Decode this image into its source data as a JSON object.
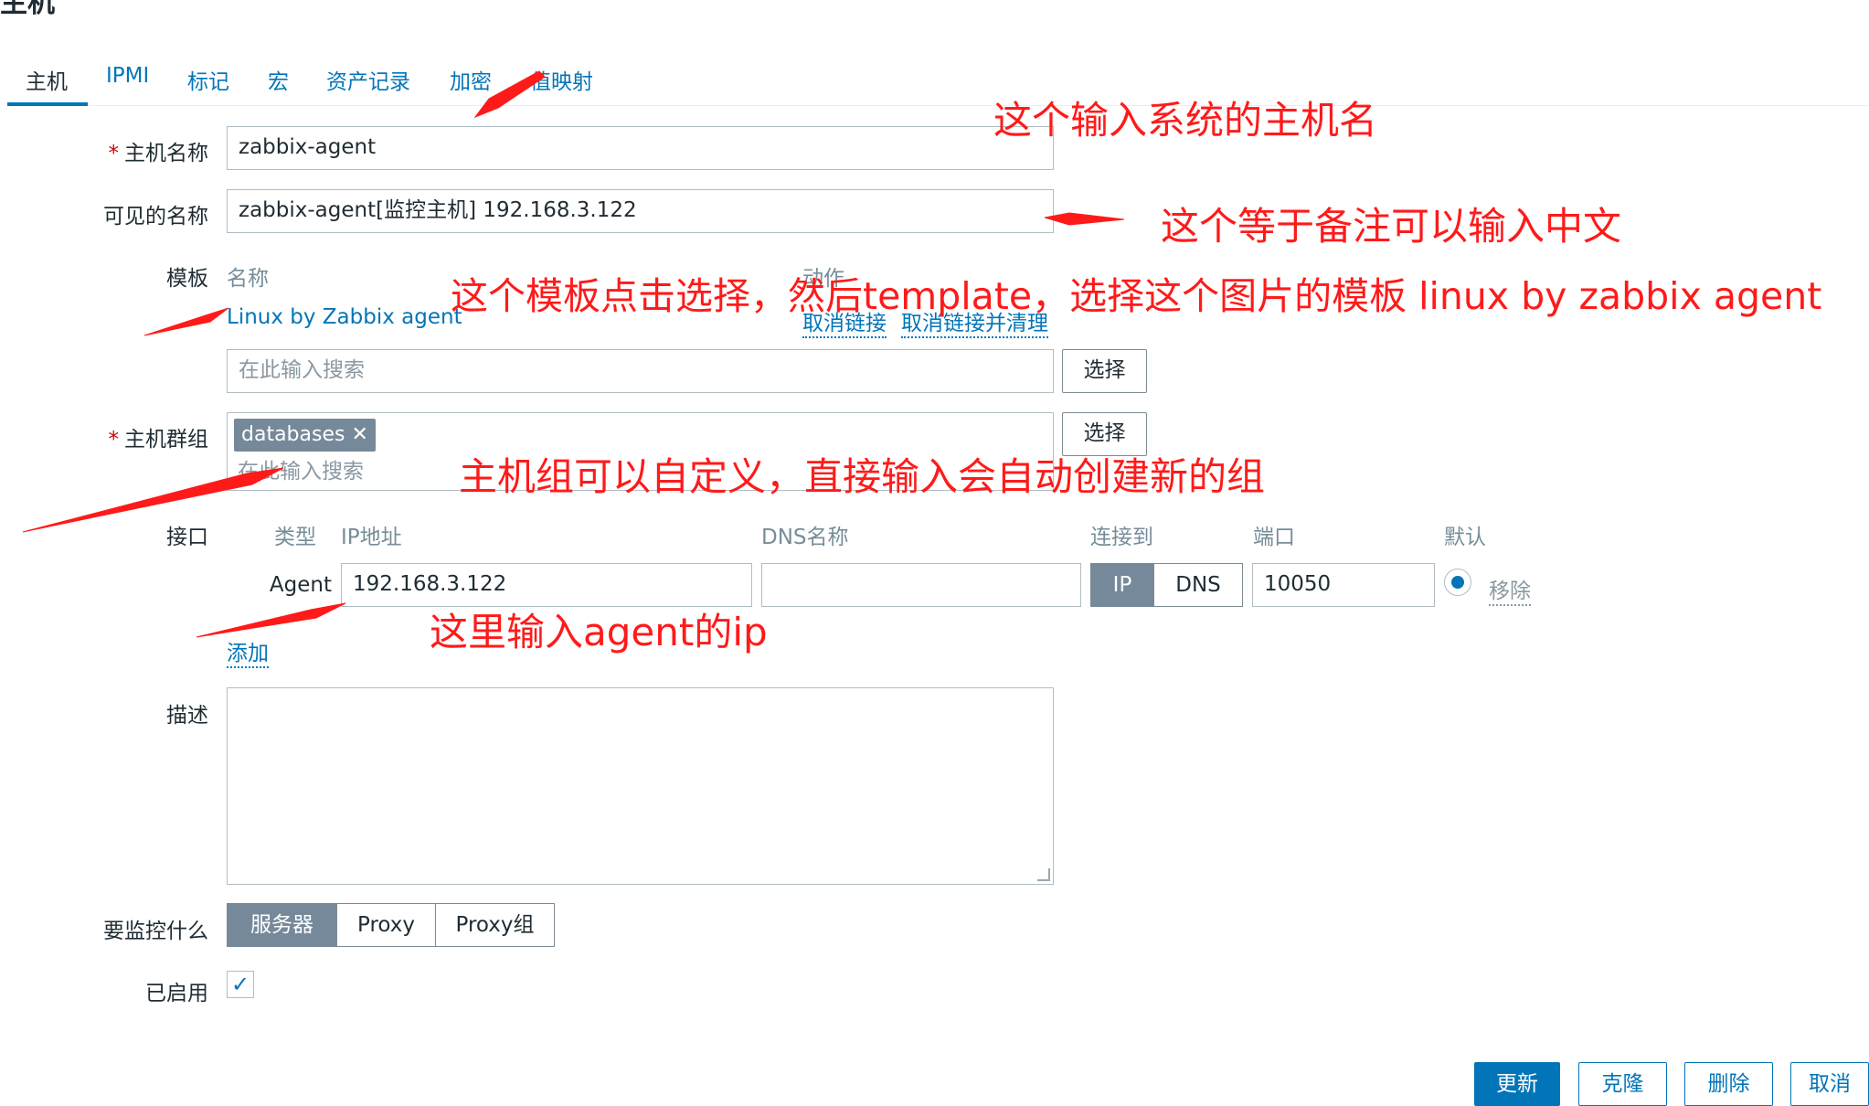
{
  "page": {
    "title": "主机"
  },
  "tabs": [
    "主机",
    "IPMI",
    "标记",
    "宏",
    "资产记录",
    "加密",
    "值映射"
  ],
  "form": {
    "hostname": {
      "label": "主机名称",
      "value": "zabbix-agent"
    },
    "visible_name": {
      "label": "可见的名称",
      "value": "zabbix-agent[监控主机] 192.168.3.122"
    },
    "templates": {
      "label": "模板",
      "col_name": "名称",
      "col_action": "动作",
      "linked": "Linux by Zabbix agent",
      "unlink": "取消链接",
      "unlink_clear": "取消链接并清理",
      "search_placeholder": "在此输入搜索",
      "select_label": "选择"
    },
    "host_groups": {
      "label": "主机群组",
      "tag": "databases",
      "search_placeholder": "在此输入搜索",
      "select_label": "选择"
    },
    "interfaces": {
      "label": "接口",
      "headers": {
        "type": "类型",
        "ip": "IP地址",
        "dns": "DNS名称",
        "connect": "连接到",
        "port": "端口",
        "default": "默认"
      },
      "row": {
        "type": "Agent",
        "ip": "192.168.3.122",
        "dns": "",
        "connect_ip": "IP",
        "connect_dns": "DNS",
        "port": "10050",
        "remove": "移除"
      },
      "add": "添加"
    },
    "description": {
      "label": "描述",
      "value": ""
    },
    "monitored_by": {
      "label": "要监控什么",
      "options": [
        "服务器",
        "Proxy",
        "Proxy组"
      ],
      "selected": "服务器"
    },
    "enabled": {
      "label": "已启用",
      "checked": true
    }
  },
  "actions": [
    "更新",
    "克隆",
    "删除",
    "取消"
  ],
  "annotations": {
    "hostname_note": "这个输入系统的主机名",
    "visible_note": "这个等于备注可以输入中文",
    "template_note": "这个模板点击选择，然后template，选择这个图片的模板 linux by zabbix agent",
    "group_note": "主机组可以自定义，直接输入会自动创建新的组",
    "ip_note": "这里输入agent的ip"
  },
  "colors": {
    "accent": "#0275b8",
    "annotation": "#ff1a1a",
    "tag_bg": "#76899a"
  }
}
